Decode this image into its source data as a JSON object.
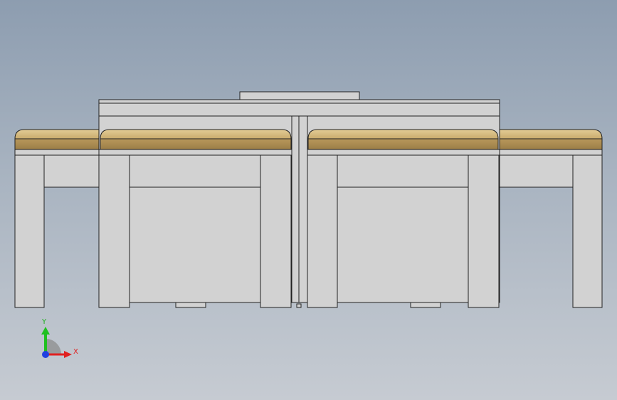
{
  "app": {
    "view": "cad-front-view"
  },
  "colors": {
    "background_top": "#8d9db0",
    "background_bottom": "#c6cbd2",
    "body_gray": "#d2d2d2",
    "edge": "#222222",
    "cushion_light": "#d7bd84",
    "cushion_dark": "#a8884f",
    "axis_x": "#e02020",
    "axis_y": "#20c020",
    "axis_z": "#2040e0"
  },
  "triad": {
    "x_label": "X",
    "y_label": "Y",
    "icons": [
      "triad-x-arrow-icon",
      "triad-y-arrow-icon",
      "triad-z-dot-icon",
      "triad-rotation-arc-icon"
    ]
  }
}
